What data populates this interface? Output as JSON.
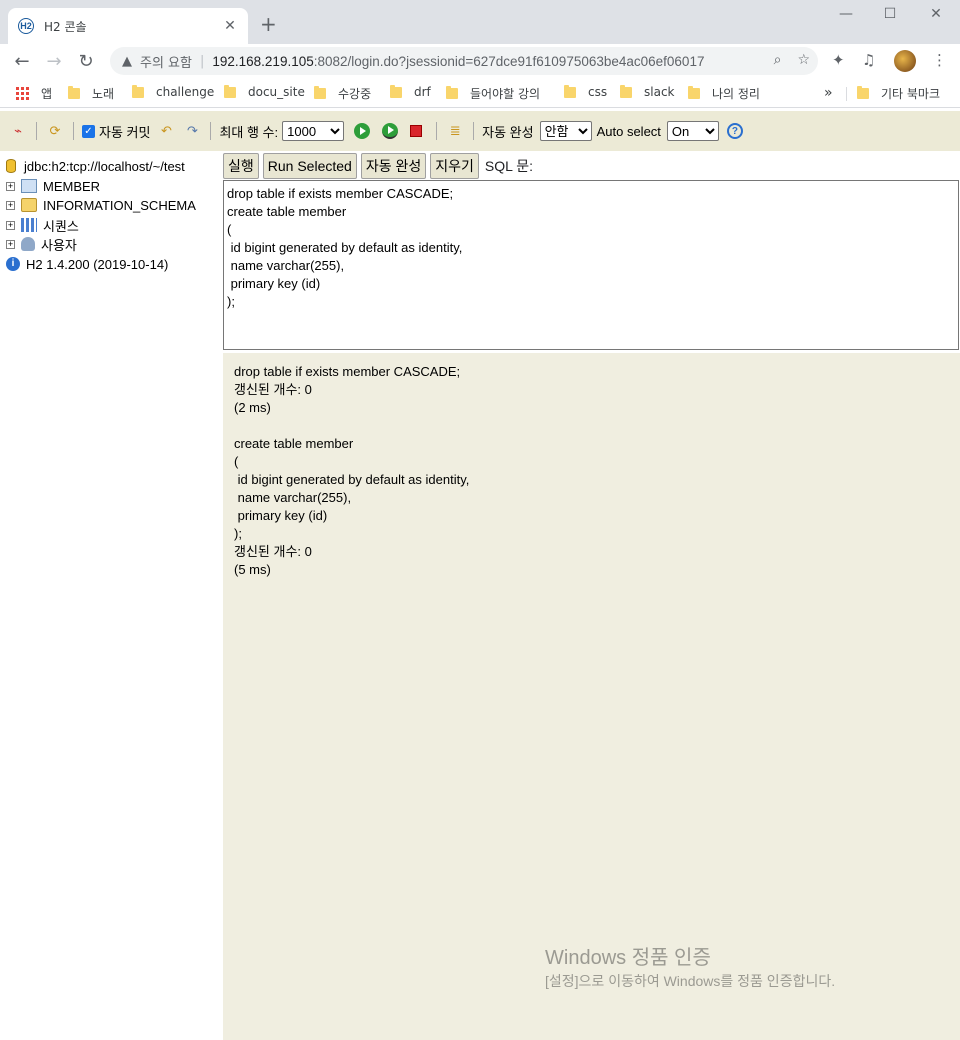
{
  "browser": {
    "tab_title": "H2 콘솔",
    "favicon_text": "H2",
    "omnibox": {
      "security_label": "주의 요함",
      "url_host": "192.168.219.105",
      "url_rest": ":8082/login.do?jsessionid=627dce91f610975063be4ac06ef06017"
    },
    "bookmarks": [
      {
        "label": "앱"
      },
      {
        "label": "노래"
      },
      {
        "label": "challenge"
      },
      {
        "label": "docu_site"
      },
      {
        "label": "수강중"
      },
      {
        "label": "drf"
      },
      {
        "label": "들어야할 강의"
      },
      {
        "label": "css"
      },
      {
        "label": "slack"
      },
      {
        "label": "나의 정리"
      }
    ],
    "other_bookmarks": "기타 북마크",
    "overflow": "»"
  },
  "h2_toolbar": {
    "autocommit_label": "자동 커밋",
    "max_rows_label": "최대 행 수:",
    "max_rows_value": "1000",
    "autocomplete_label": "자동 완성",
    "autocomplete_value": "안함",
    "autoselect_label": "Auto select",
    "autoselect_value": "On"
  },
  "tree": {
    "connection": "jdbc:h2:tcp://localhost/~/test",
    "items": [
      {
        "label": "MEMBER"
      },
      {
        "label": "INFORMATION_SCHEMA"
      },
      {
        "label": "시퀀스"
      },
      {
        "label": "사용자"
      }
    ],
    "version": "H2 1.4.200 (2019-10-14)"
  },
  "query_buttons": {
    "run": "실행",
    "run_selected": "Run Selected",
    "autocomplete": "자동 완성",
    "clear": "지우기",
    "sql_label": "SQL 문:"
  },
  "editor_text": "drop table if exists member CASCADE;\ncreate table member\n(\n id bigint generated by default as identity,\n name varchar(255),\n primary key (id)\n);",
  "output_lines": [
    "drop table if exists member CASCADE;",
    "갱신된 개수: 0",
    "(2 ms)",
    "",
    "create table member",
    "(",
    " id bigint generated by default as identity,",
    " name varchar(255),",
    " primary key (id)",
    ");",
    "갱신된 개수: 0",
    "(5 ms)"
  ],
  "watermark": {
    "line1": "Windows 정품 인증",
    "line2": "[설정]으로 이동하여 Windows를 정품 인증합니다."
  },
  "colors": {
    "h2_toolbar_bg": "#ecead6",
    "output_bg": "#f0eee0"
  }
}
